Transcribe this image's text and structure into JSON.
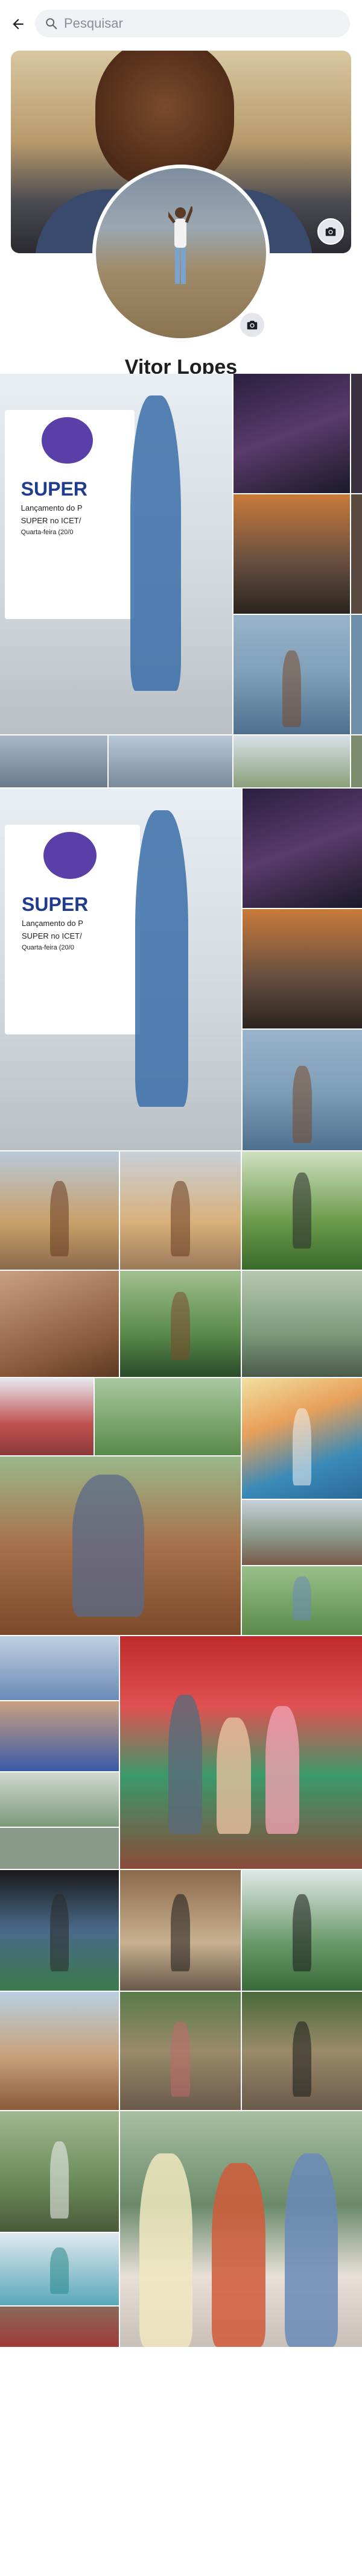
{
  "search": {
    "placeholder": "Pesquisar"
  },
  "profile": {
    "name": "Vitor Lopes"
  },
  "banner": {
    "brand": "SUPER",
    "line1": "Lançamento do P",
    "line2": "SUPER no ICET/",
    "line3": "Quarta-feira (20/0"
  },
  "colors": {
    "accent": "#1877f2",
    "search_bg": "#f0f2f5",
    "text": "#1c1e21",
    "muted": "#8a8d91"
  },
  "icons": [
    "back-arrow-icon",
    "search-icon",
    "camera-icon"
  ],
  "photos": [
    "banner-photo-1",
    "night-photo",
    "sunset-photo",
    "river-photo",
    "kids-photo",
    "small-photo-1",
    "small-photo-2",
    "small-photo-3",
    "banner-photo-2",
    "night-photo-2",
    "sunset-photo-2",
    "river-photo-2",
    "beach-photo-1",
    "beach-photo-2",
    "standing-photo",
    "shirtless-photo",
    "tree-photo",
    "bench-photo",
    "city-photo",
    "sitting-photo",
    "fish-mural-photo",
    "street-photo",
    "portrait-photo",
    "river-small-1",
    "shirtless-small",
    "boy-small",
    "family-photo",
    "railing-photo",
    "doorway-photo",
    "field-photo",
    "brick-photo",
    "fence-photo-1",
    "fence-photo-2",
    "river-small-2",
    "group-photo",
    "tree-small",
    "pool-photo",
    "house-photo"
  ]
}
